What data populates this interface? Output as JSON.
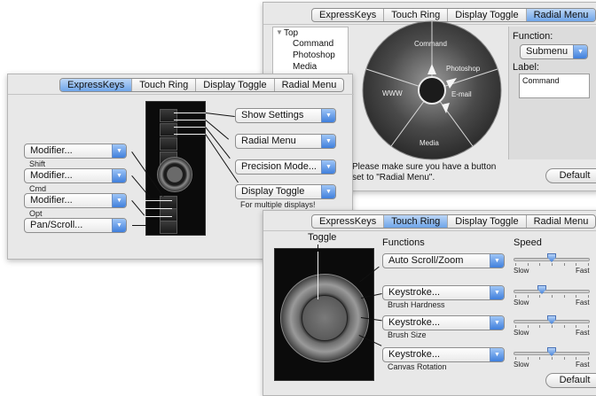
{
  "radial_panel": {
    "tabs": [
      "ExpressKeys",
      "Touch Ring",
      "Display Toggle",
      "Radial Menu"
    ],
    "active_tab": "Radial Menu",
    "tree": {
      "root": "Top",
      "items": [
        "Command",
        "Photoshop",
        "Media"
      ]
    },
    "wheel": {
      "segments": [
        "Command",
        "Photoshop",
        "E-mail",
        "Media",
        "WWW"
      ]
    },
    "function_label": "Function:",
    "function_value": "Submenu",
    "label_label": "Label:",
    "label_value": "Command",
    "note": "Please make sure you have a button set to \"Radial Menu\".",
    "default_button": "Default"
  },
  "expresskeys_panel": {
    "tabs": [
      "ExpressKeys",
      "Touch Ring",
      "Display Toggle",
      "Radial Menu"
    ],
    "active_tab": "ExpressKeys",
    "left_keys": [
      {
        "value": "Modifier...",
        "caption": "Shift"
      },
      {
        "value": "Modifier...",
        "caption": "Cmd"
      },
      {
        "value": "Modifier...",
        "caption": "Opt"
      },
      {
        "value": "Pan/Scroll...",
        "caption": ""
      }
    ],
    "right_keys": [
      {
        "value": "Show Settings",
        "caption": ""
      },
      {
        "value": "Radial Menu",
        "caption": ""
      },
      {
        "value": "Precision Mode...",
        "caption": ""
      },
      {
        "value": "Display Toggle",
        "caption": "For multiple displays!"
      }
    ]
  },
  "touchring_panel": {
    "tabs": [
      "ExpressKeys",
      "Touch Ring",
      "Display Toggle",
      "Radial Menu"
    ],
    "active_tab": "Touch Ring",
    "toggle_label": "Toggle",
    "functions_header": "Functions",
    "speed_header": "Speed",
    "rows": [
      {
        "value": "Auto Scroll/Zoom",
        "caption": "",
        "speed": 0.5
      },
      {
        "value": "Keystroke...",
        "caption": "Brush Hardness",
        "speed": 0.35
      },
      {
        "value": "Keystroke...",
        "caption": "Brush Size",
        "speed": 0.5
      },
      {
        "value": "Keystroke...",
        "caption": "Canvas Rotation",
        "speed": 0.5
      }
    ],
    "slow_label": "Slow",
    "fast_label": "Fast",
    "default_button": "Default"
  },
  "colors": {
    "accent": "#4d88dc",
    "panel_bg": "#e8e8e8",
    "device_bg": "#0b0b0b"
  }
}
